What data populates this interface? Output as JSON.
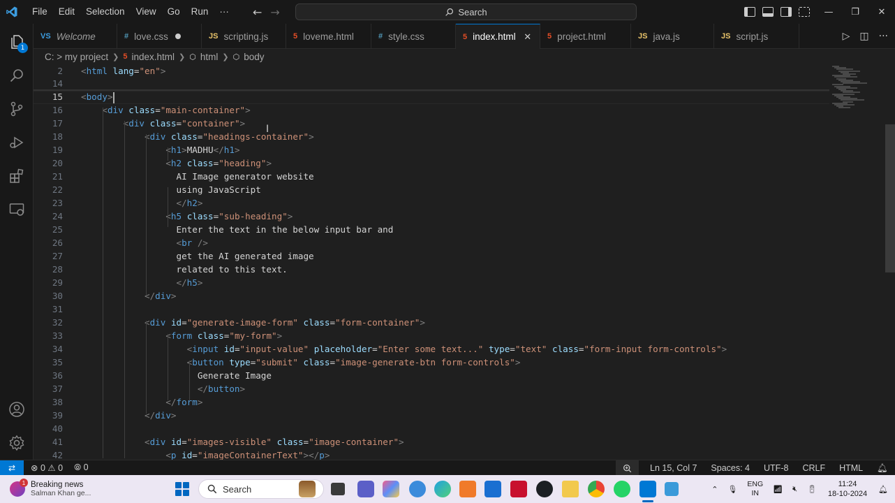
{
  "titlebar": {
    "menu": [
      "File",
      "Edit",
      "Selection",
      "View",
      "Go",
      "Run",
      "···"
    ],
    "search_label": "Search"
  },
  "activitybar": {
    "explorer_badge": "1"
  },
  "tabs": [
    {
      "label": "Welcome",
      "type": "vs",
      "icon": "VS",
      "italic": true
    },
    {
      "label": "love.css",
      "type": "css",
      "icon": "#",
      "dirty": true
    },
    {
      "label": "scripting.js",
      "type": "js",
      "icon": "JS"
    },
    {
      "label": "loveme.html",
      "type": "html",
      "icon": "5"
    },
    {
      "label": "style.css",
      "type": "css",
      "icon": "#"
    },
    {
      "label": "index.html",
      "type": "html",
      "icon": "5",
      "active": true
    },
    {
      "label": "project.html",
      "type": "html",
      "icon": "5"
    },
    {
      "label": "java.js",
      "type": "js",
      "icon": "JS"
    },
    {
      "label": "script.js",
      "type": "js",
      "icon": "JS"
    }
  ],
  "breadcrumb": [
    "C: > my project",
    "index.html",
    "html",
    "body"
  ],
  "editor": {
    "lines": [
      {
        "n": "2",
        "t": [
          [
            "t",
            "<"
          ],
          [
            "n",
            "html"
          ],
          [
            "s",
            " "
          ],
          [
            "a",
            "lang"
          ],
          [
            "x",
            "="
          ],
          [
            "v",
            "\"en\""
          ],
          [
            "t",
            ">"
          ]
        ]
      },
      {
        "n": "14",
        "t": []
      },
      {
        "n": "15",
        "t": [
          [
            "t",
            "<"
          ],
          [
            "n",
            "body"
          ],
          [
            "t",
            ">"
          ]
        ],
        "cursor": true
      },
      {
        "n": "16",
        "t": [
          [
            "s",
            "    "
          ],
          [
            "t",
            "<"
          ],
          [
            "n",
            "div"
          ],
          [
            "s",
            " "
          ],
          [
            "a",
            "class"
          ],
          [
            "x",
            "="
          ],
          [
            "v",
            "\"main-container\""
          ],
          [
            "t",
            ">"
          ]
        ]
      },
      {
        "n": "17",
        "t": [
          [
            "s",
            "        "
          ],
          [
            "t",
            "<"
          ],
          [
            "n",
            "div"
          ],
          [
            "s",
            " "
          ],
          [
            "a",
            "class"
          ],
          [
            "x",
            "="
          ],
          [
            "v",
            "\"container\""
          ],
          [
            "t",
            ">"
          ]
        ]
      },
      {
        "n": "18",
        "t": [
          [
            "s",
            "            "
          ],
          [
            "t",
            "<"
          ],
          [
            "n",
            "div"
          ],
          [
            "s",
            " "
          ],
          [
            "a",
            "class"
          ],
          [
            "x",
            "="
          ],
          [
            "v",
            "\"headings-container\""
          ],
          [
            "t",
            ">"
          ]
        ]
      },
      {
        "n": "19",
        "t": [
          [
            "s",
            "                "
          ],
          [
            "t",
            "<"
          ],
          [
            "n",
            "h1"
          ],
          [
            "t",
            ">"
          ],
          [
            "x",
            "MADHU"
          ],
          [
            "t",
            "</"
          ],
          [
            "n",
            "h1"
          ],
          [
            "t",
            ">"
          ]
        ]
      },
      {
        "n": "20",
        "t": [
          [
            "s",
            "                "
          ],
          [
            "t",
            "<"
          ],
          [
            "n",
            "h2"
          ],
          [
            "s",
            " "
          ],
          [
            "a",
            "class"
          ],
          [
            "x",
            "="
          ],
          [
            "v",
            "\"heading\""
          ],
          [
            "t",
            ">"
          ]
        ]
      },
      {
        "n": "21",
        "t": [
          [
            "s",
            "                  "
          ],
          [
            "x",
            "AI Image generator website"
          ]
        ]
      },
      {
        "n": "22",
        "t": [
          [
            "s",
            "                  "
          ],
          [
            "x",
            "using JavaScript"
          ]
        ]
      },
      {
        "n": "23",
        "t": [
          [
            "s",
            "                  "
          ],
          [
            "t",
            "</"
          ],
          [
            "n",
            "h2"
          ],
          [
            "t",
            ">"
          ]
        ]
      },
      {
        "n": "24",
        "t": [
          [
            "s",
            "                "
          ],
          [
            "t",
            "<"
          ],
          [
            "n",
            "h5"
          ],
          [
            "s",
            " "
          ],
          [
            "a",
            "class"
          ],
          [
            "x",
            "="
          ],
          [
            "v",
            "\"sub-heading\""
          ],
          [
            "t",
            ">"
          ]
        ]
      },
      {
        "n": "25",
        "t": [
          [
            "s",
            "                  "
          ],
          [
            "x",
            "Enter the text in the below input bar and"
          ]
        ]
      },
      {
        "n": "26",
        "t": [
          [
            "s",
            "                  "
          ],
          [
            "t",
            "<"
          ],
          [
            "n",
            "br"
          ],
          [
            "s",
            " "
          ],
          [
            "t",
            "/>"
          ]
        ]
      },
      {
        "n": "27",
        "t": [
          [
            "s",
            "                  "
          ],
          [
            "x",
            "get the AI generated image"
          ]
        ]
      },
      {
        "n": "28",
        "t": [
          [
            "s",
            "                  "
          ],
          [
            "x",
            "related to this text."
          ]
        ]
      },
      {
        "n": "29",
        "t": [
          [
            "s",
            "                  "
          ],
          [
            "t",
            "</"
          ],
          [
            "n",
            "h5"
          ],
          [
            "t",
            ">"
          ]
        ]
      },
      {
        "n": "30",
        "t": [
          [
            "s",
            "            "
          ],
          [
            "t",
            "</"
          ],
          [
            "n",
            "div"
          ],
          [
            "t",
            ">"
          ]
        ]
      },
      {
        "n": "31",
        "t": []
      },
      {
        "n": "32",
        "t": [
          [
            "s",
            "            "
          ],
          [
            "t",
            "<"
          ],
          [
            "n",
            "div"
          ],
          [
            "s",
            " "
          ],
          [
            "a",
            "id"
          ],
          [
            "x",
            "="
          ],
          [
            "v",
            "\"generate-image-form\""
          ],
          [
            "s",
            " "
          ],
          [
            "a",
            "class"
          ],
          [
            "x",
            "="
          ],
          [
            "v",
            "\"form-container\""
          ],
          [
            "t",
            ">"
          ]
        ]
      },
      {
        "n": "33",
        "t": [
          [
            "s",
            "                "
          ],
          [
            "t",
            "<"
          ],
          [
            "n",
            "form"
          ],
          [
            "s",
            " "
          ],
          [
            "a",
            "class"
          ],
          [
            "x",
            "="
          ],
          [
            "v",
            "\"my-form\""
          ],
          [
            "t",
            ">"
          ]
        ]
      },
      {
        "n": "34",
        "t": [
          [
            "s",
            "                    "
          ],
          [
            "t",
            "<"
          ],
          [
            "n",
            "input"
          ],
          [
            "s",
            " "
          ],
          [
            "a",
            "id"
          ],
          [
            "x",
            "="
          ],
          [
            "v",
            "\"input-value\""
          ],
          [
            "s",
            " "
          ],
          [
            "a",
            "placeholder"
          ],
          [
            "x",
            "="
          ],
          [
            "v",
            "\"Enter some text...\""
          ],
          [
            "s",
            " "
          ],
          [
            "a",
            "type"
          ],
          [
            "x",
            "="
          ],
          [
            "v",
            "\"text\""
          ],
          [
            "s",
            " "
          ],
          [
            "a",
            "class"
          ],
          [
            "x",
            "="
          ],
          [
            "v",
            "\"form-input form-controls\""
          ],
          [
            "t",
            ">"
          ]
        ]
      },
      {
        "n": "35",
        "t": [
          [
            "s",
            "                    "
          ],
          [
            "t",
            "<"
          ],
          [
            "n",
            "button"
          ],
          [
            "s",
            " "
          ],
          [
            "a",
            "type"
          ],
          [
            "x",
            "="
          ],
          [
            "v",
            "\"submit\""
          ],
          [
            "s",
            " "
          ],
          [
            "a",
            "class"
          ],
          [
            "x",
            "="
          ],
          [
            "v",
            "\"image-generate-btn form-controls\""
          ],
          [
            "t",
            ">"
          ]
        ]
      },
      {
        "n": "36",
        "t": [
          [
            "s",
            "                      "
          ],
          [
            "x",
            "Generate Image"
          ]
        ]
      },
      {
        "n": "37",
        "t": [
          [
            "s",
            "                      "
          ],
          [
            "t",
            "</"
          ],
          [
            "n",
            "button"
          ],
          [
            "t",
            ">"
          ]
        ]
      },
      {
        "n": "38",
        "t": [
          [
            "s",
            "                "
          ],
          [
            "t",
            "</"
          ],
          [
            "n",
            "form"
          ],
          [
            "t",
            ">"
          ]
        ]
      },
      {
        "n": "39",
        "t": [
          [
            "s",
            "            "
          ],
          [
            "t",
            "</"
          ],
          [
            "n",
            "div"
          ],
          [
            "t",
            ">"
          ]
        ]
      },
      {
        "n": "40",
        "t": []
      },
      {
        "n": "41",
        "t": [
          [
            "s",
            "            "
          ],
          [
            "t",
            "<"
          ],
          [
            "n",
            "div"
          ],
          [
            "s",
            " "
          ],
          [
            "a",
            "id"
          ],
          [
            "x",
            "="
          ],
          [
            "v",
            "\"images-visible\""
          ],
          [
            "s",
            " "
          ],
          [
            "a",
            "class"
          ],
          [
            "x",
            "="
          ],
          [
            "v",
            "\"image-container\""
          ],
          [
            "t",
            ">"
          ]
        ]
      },
      {
        "n": "42",
        "t": [
          [
            "s",
            "                "
          ],
          [
            "t",
            "<"
          ],
          [
            "n",
            "p"
          ],
          [
            "s",
            " "
          ],
          [
            "a",
            "id"
          ],
          [
            "x",
            "="
          ],
          [
            "v",
            "\"imageContainerText\""
          ],
          [
            "t",
            "></"
          ],
          [
            "n",
            "p"
          ],
          [
            "t",
            ">"
          ]
        ]
      }
    ]
  },
  "statusbar": {
    "errors": "0",
    "warnings": "0",
    "ports": "0",
    "position": "Ln 15, Col 7",
    "spaces": "Spaces: 4",
    "encoding": "UTF-8",
    "eol": "CRLF",
    "language": "HTML"
  },
  "taskbar": {
    "news_title": "Breaking news",
    "news_sub": "Salman Khan ge...",
    "news_badge": "1",
    "search_label": "Search",
    "lang_top": "ENG",
    "lang_bottom": "IN",
    "time": "11:24",
    "date": "18-10-2024"
  },
  "colors": {
    "accent": "#0078d4",
    "tag": "#569cd6",
    "attr": "#9cdcfe",
    "string": "#ce9178"
  }
}
